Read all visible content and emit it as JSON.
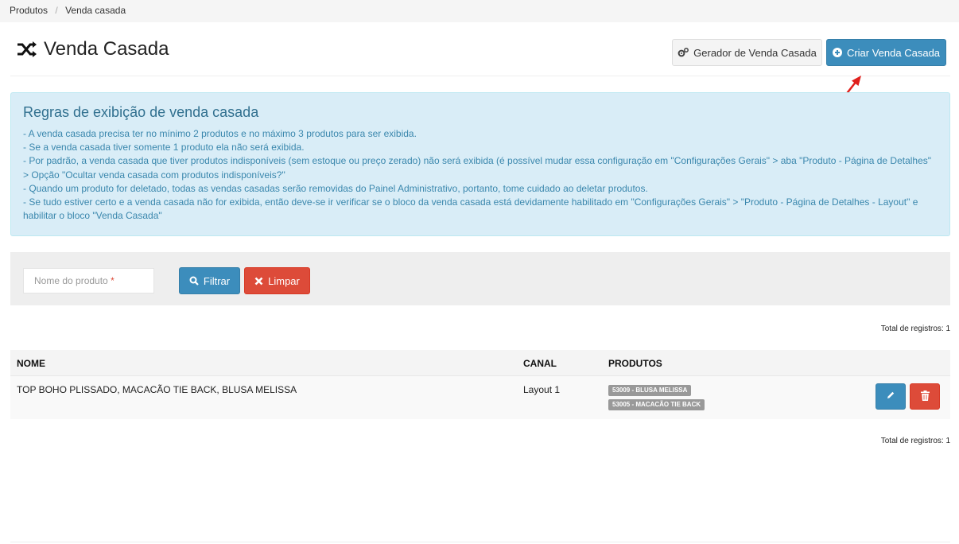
{
  "breadcrumb": {
    "items": [
      "Produtos",
      "Venda casada"
    ]
  },
  "header": {
    "title": "Venda Casada",
    "gerador_label": "Gerador de Venda Casada",
    "criar_label": "Criar Venda Casada"
  },
  "callout": {
    "title": "Regras de exibição de venda casada",
    "lines": [
      "- A venda casada precisa ter no mínimo 2 produtos e no máximo 3 produtos para ser exibida.",
      "- Se a venda casada tiver somente 1 produto ela não será exibida.",
      "- Por padrão, a venda casada que tiver produtos indisponíveis (sem estoque ou preço zerado) não será exibida (é possível mudar essa configuração em \"Configurações Gerais\" > aba \"Produto - Página de Detalhes\" > Opção \"Ocultar venda casada com produtos indisponíveis?\"",
      "- Quando um produto for deletado, todas as vendas casadas serão removidas do Painel Administrativo, portanto, tome cuidado ao deletar produtos.",
      "- Se tudo estiver certo e a venda casada não for exibida, então deve-se ir verificar se o bloco da venda casada está devidamente habilitado em \"Configurações Gerais\" > \"Produto - Página de Detalhes - Layout\" e habilitar o bloco \"Venda Casada\""
    ]
  },
  "filter": {
    "placeholder": "Nome do produto",
    "required_mark": "*",
    "filtrar_label": "Filtrar",
    "limpar_label": "Limpar"
  },
  "total_label": "Total de registros: 1",
  "table": {
    "columns": [
      "NOME",
      "CANAL",
      "PRODUTOS"
    ],
    "rows": [
      {
        "nome": "TOP BOHO PLISSADO, MACACÃO TIE BACK, BLUSA MELISSA",
        "canal": "Layout 1",
        "produtos": [
          "53009 - BLUSA MELISSA",
          "53005 - MACACÃO TIE BACK"
        ]
      }
    ]
  },
  "colors": {
    "primary": "#3c8dbc",
    "danger": "#dd4b39",
    "info_bg": "#d9edf7",
    "annotation_arrow": "#e0201c"
  }
}
